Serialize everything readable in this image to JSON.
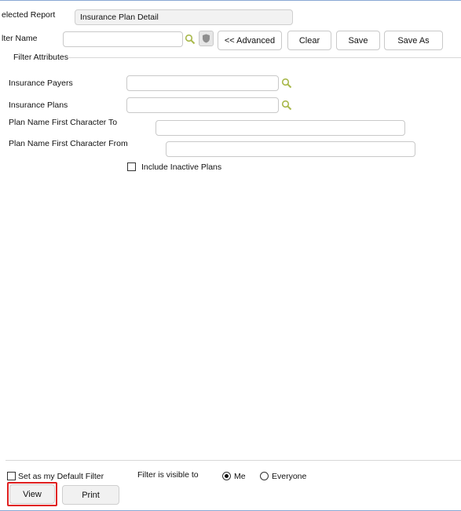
{
  "header": {
    "selected_report_label": "elected Report",
    "selected_report_value": "Insurance Plan Detail",
    "filter_name_label": "lter Name",
    "filter_name_value": "",
    "advanced_button": "<< Advanced",
    "clear_button": "Clear",
    "save_button": "Save",
    "save_as_button": "Save As"
  },
  "filter_attributes": {
    "section_title": "Filter Attributes",
    "insurance_payers_label": "Insurance Payers",
    "insurance_payers_value": "",
    "insurance_plans_label": "Insurance Plans",
    "insurance_plans_value": "",
    "plan_name_to_label": "Plan Name First Character To",
    "plan_name_to_value": "",
    "plan_name_from_label": "Plan Name First Character From",
    "plan_name_from_value": "",
    "include_inactive_label": "Include Inactive Plans",
    "include_inactive_checked": false
  },
  "footer": {
    "default_filter_label": "Set as my Default Filter",
    "visibility_label": "Filter is visible to",
    "radio_me_label": "Me",
    "radio_everyone_label": "Everyone",
    "selected_visibility": "Me",
    "view_button": "View",
    "print_button": "Print"
  },
  "colors": {
    "highlight": "#e02020",
    "search_icon": "#a8b84a",
    "frame": "#8aa8d4"
  },
  "icons": [
    "search-icon",
    "shield-icon"
  ]
}
